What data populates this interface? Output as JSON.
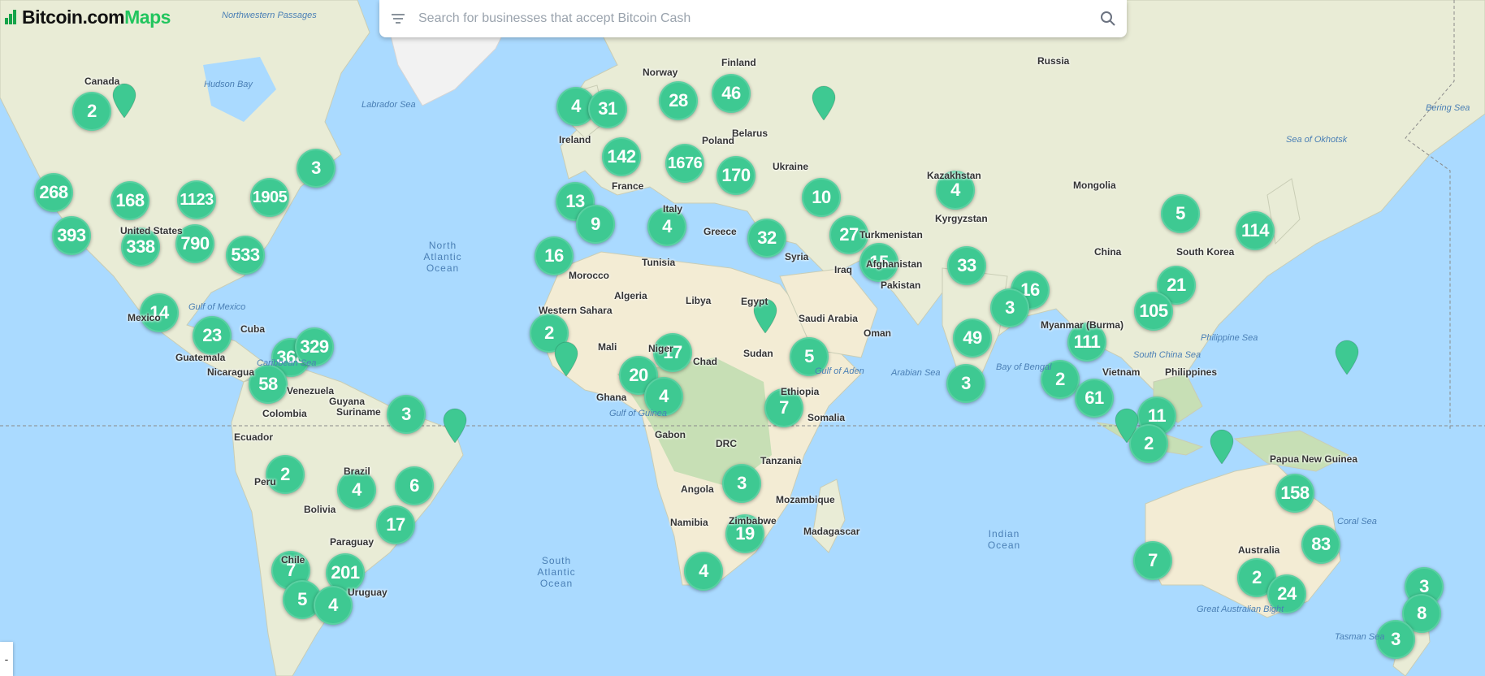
{
  "logo": {
    "brand": "Bitcoin.com",
    "product": "Maps"
  },
  "search": {
    "placeholder": "Search for businesses that accept Bitcoin Cash"
  },
  "zoom_out_label": "-",
  "colors": {
    "cluster": "#3ec992",
    "ocean": "#aadaff",
    "land": "#e9ecd6",
    "forest": "#c7dfb5",
    "desert": "#f3ecd4",
    "brand": "#22c55e"
  },
  "clusters": [
    "2",
    "268",
    "168",
    "1123",
    "1905",
    "3",
    "393",
    "338",
    "790",
    "533",
    "14",
    "23",
    "368",
    "329",
    "58",
    "3",
    "2",
    "4",
    "6",
    "17",
    "7",
    "201",
    "5",
    "4",
    "4",
    "31",
    "28",
    "46",
    "142",
    "1676",
    "170",
    "13",
    "9",
    "4",
    "16",
    "2",
    "17",
    "20",
    "4",
    "5",
    "7",
    "3",
    "19",
    "4",
    "10",
    "32",
    "27",
    "15",
    "4",
    "33",
    "16",
    "3",
    "49",
    "3",
    "111",
    "2",
    "61",
    "5",
    "114",
    "21",
    "105",
    "11",
    "2",
    "158",
    "83",
    "7",
    "2",
    "24",
    "3",
    "8",
    "3"
  ],
  "pins": [
    "pin",
    "pin",
    "pin",
    "pin",
    "pin",
    "pin",
    "pin",
    "pin"
  ],
  "labels": {
    "countries": [
      "Canada",
      "United States",
      "Mexico",
      "Cuba",
      "Guatemala",
      "Nicaragua",
      "Venezuela",
      "Colombia",
      "Guyana",
      "Suriname",
      "Ecuador",
      "Peru",
      "Brazil",
      "Bolivia",
      "Paraguay",
      "Chile",
      "Uruguay",
      "Norway",
      "Finland",
      "Russia",
      "Ireland",
      "Poland",
      "Belarus",
      "Ukraine",
      "France",
      "Italy",
      "Greece",
      "Tunisia",
      "Morocco",
      "Algeria",
      "Libya",
      "Egypt",
      "Western Sahara",
      "Mali",
      "Chad",
      "Sudan",
      "Niger",
      "Ghana",
      "Gabon",
      "DRC",
      "Angola",
      "Namibia",
      "Tanzania",
      "Mozambique",
      "Zimbabwe",
      "Madagascar",
      "Somalia",
      "Ethiopia",
      "Saudi Arabia",
      "Oman",
      "Iraq",
      "Syria",
      "Turkmenistan",
      "Afghanistan",
      "Pakistan",
      "Kazakhstan",
      "Kyrgyzstan",
      "Mongolia",
      "China",
      "South Korea",
      "Myanmar (Burma)",
      "Vietnam",
      "Philippines",
      "Papua New Guinea",
      "Australia"
    ],
    "seas": [
      "Hudson Bay",
      "Labrador Sea",
      "Gulf of Mexico",
      "Northwestern Passages",
      "Caribbean Sea",
      "Sea of Okhotsk",
      "Bering Sea",
      "Arabian Sea",
      "Bay of Bengal",
      "South China Sea",
      "Philippine Sea",
      "Coral Sea",
      "Tasman Sea",
      "Great Australian Bight",
      "Gulf of Aden",
      "Gulf of Guinea"
    ],
    "oceans": [
      "North Atlantic Ocean",
      "South Atlantic Ocean",
      "Indian Ocean"
    ]
  }
}
